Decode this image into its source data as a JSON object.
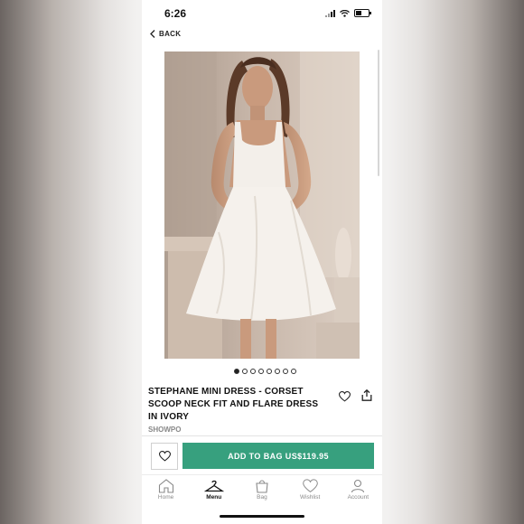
{
  "status_bar": {
    "time": "6:26"
  },
  "nav": {
    "back_label": "BACK"
  },
  "product": {
    "image_alt": "Model wearing white corset mini dress",
    "carousel": {
      "total": 8,
      "active": 1
    },
    "title": "STEPHANE MINI DRESS - CORSET SCOOP NECK FIT AND FLARE DRESS IN IVORY",
    "brand": "SHOWPO"
  },
  "actions": {
    "add_to_bag_label": "ADD TO BAG US$119.95",
    "accent_color": "#37a07e"
  },
  "tabs": [
    {
      "label": "Home",
      "icon": "home-icon",
      "active": false
    },
    {
      "label": "Menu",
      "icon": "hanger-icon",
      "active": true
    },
    {
      "label": "Bag",
      "icon": "bag-icon",
      "active": false
    },
    {
      "label": "Wishlist",
      "icon": "heart-icon",
      "active": false
    },
    {
      "label": "Account",
      "icon": "user-icon",
      "active": false
    }
  ]
}
